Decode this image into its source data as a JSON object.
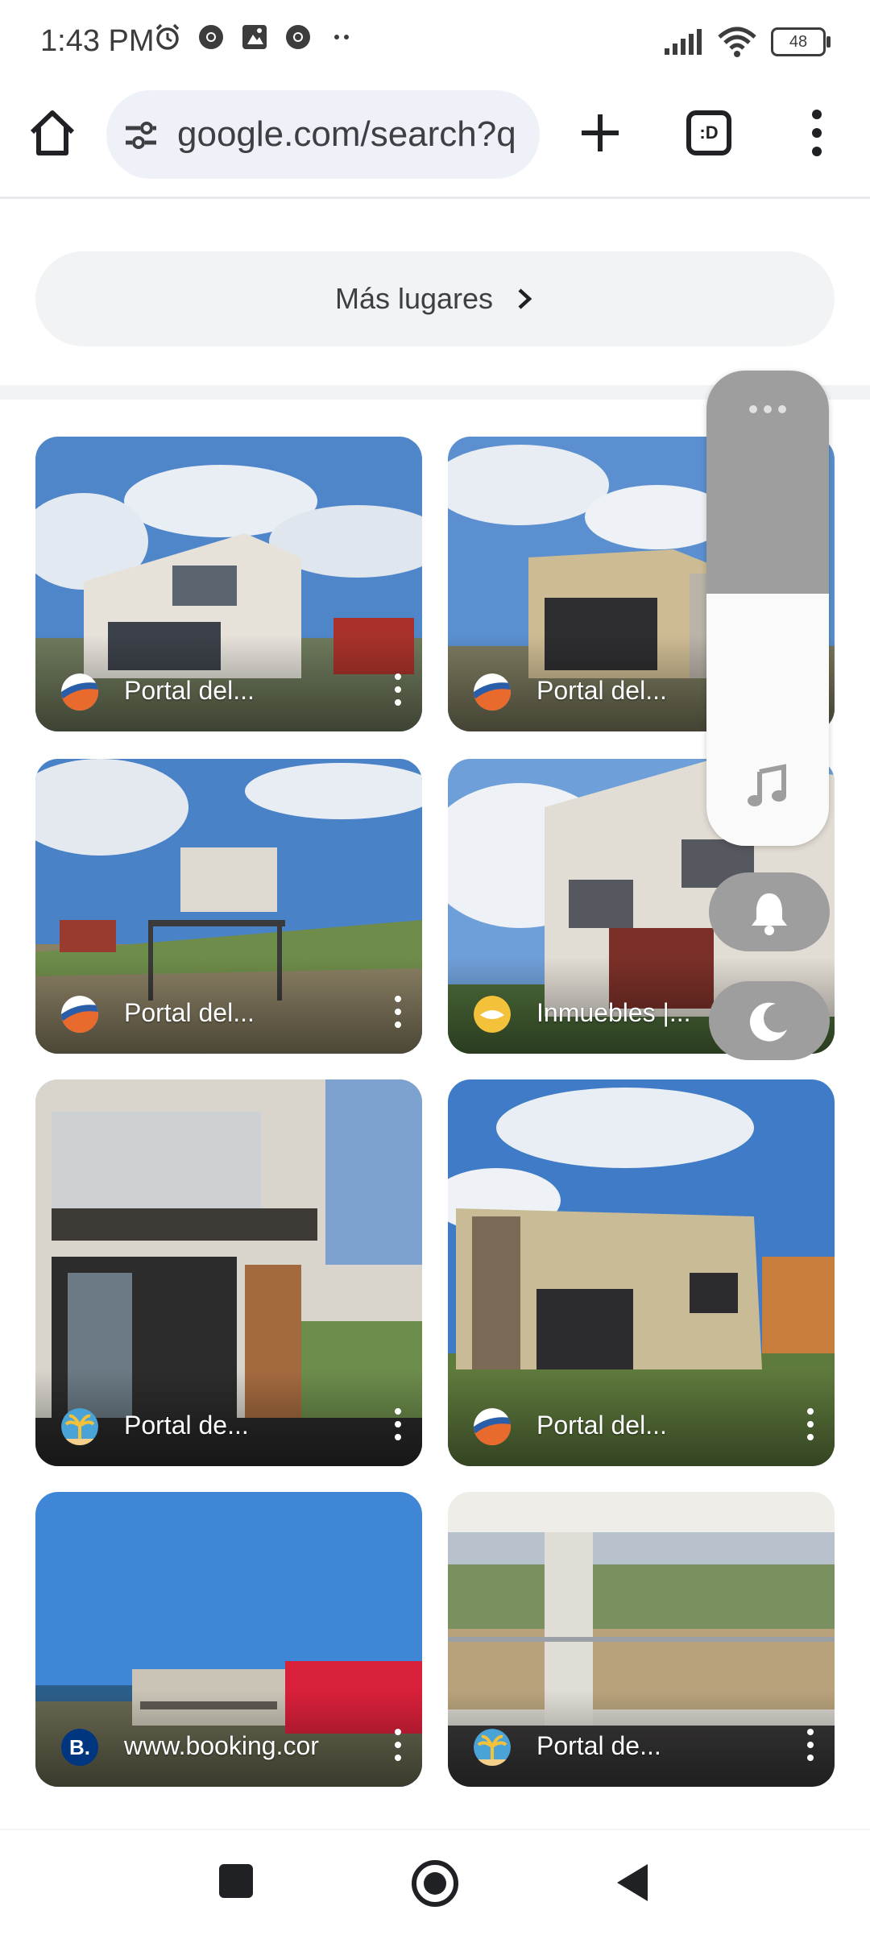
{
  "status_bar": {
    "time": "1:43 PM",
    "left_icons": [
      "alarm-icon",
      "chrome-icon",
      "photos-icon",
      "chrome-icon",
      "more-dots-icon"
    ],
    "right_icons": [
      "signal-icon",
      "wifi-icon",
      "battery-icon"
    ],
    "battery": "48"
  },
  "toolbar": {
    "url": "google.com/search?q",
    "tab_label": ":D",
    "icons": [
      "home-icon",
      "site-settings-icon",
      "new-tab-icon",
      "tab-switcher-icon",
      "overflow-menu-icon"
    ]
  },
  "more_places": {
    "label": "Más lugares"
  },
  "cards": [
    {
      "source": "Portal del...",
      "favicon": "portal-del-este"
    },
    {
      "source": "Portal del...",
      "favicon": "portal-del-este"
    },
    {
      "source": "Portal del...",
      "favicon": "portal-del-este"
    },
    {
      "source": "Inmuebles |...",
      "favicon": "inmuebles"
    },
    {
      "source": "Portal de...",
      "favicon": "portal-de-palmera"
    },
    {
      "source": "Portal del...",
      "favicon": "portal-del-este"
    },
    {
      "source": "www.booking.cor",
      "favicon": "booking",
      "favicon_letter": "B."
    },
    {
      "source": "Portal de...",
      "favicon": "portal-de-palmera"
    }
  ],
  "volume_overlay": {
    "level": 0.47,
    "icons": [
      "more-horizontal-icon",
      "music-note-icon",
      "bell-icon",
      "moon-icon"
    ]
  },
  "nav_bar": {
    "icons": [
      "recents-square-icon",
      "home-circle-icon",
      "back-triangle-icon"
    ]
  },
  "colors": {
    "url_bar_bg": "#eef1f8",
    "chip_bg": "#f1f3f4",
    "overlay_gray": "#9e9e9e",
    "booking_blue": "#003580"
  }
}
